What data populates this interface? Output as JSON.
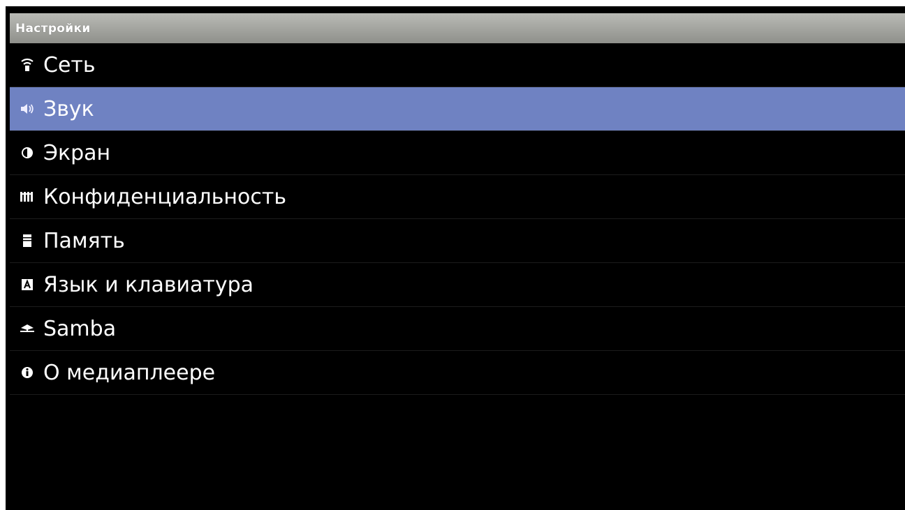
{
  "title": "Настройки",
  "items": [
    {
      "label": "Сеть",
      "icon": "wifi-icon",
      "selected": false
    },
    {
      "label": "Звук",
      "icon": "speaker-icon",
      "selected": true
    },
    {
      "label": "Экран",
      "icon": "display-icon",
      "selected": false
    },
    {
      "label": "Конфиденциальность",
      "icon": "privacy-icon",
      "selected": false
    },
    {
      "label": "Память",
      "icon": "storage-icon",
      "selected": false
    },
    {
      "label": "Язык и клавиатура",
      "icon": "keyboard-icon",
      "selected": false
    },
    {
      "label": "Samba",
      "icon": "samba-icon",
      "selected": false
    },
    {
      "label": "О медиаплеере",
      "icon": "info-icon",
      "selected": false
    }
  ],
  "colors": {
    "background": "#000000",
    "selected": "#6f82c2",
    "titlebar": "#a5a6a1",
    "text": "#ffffff"
  }
}
